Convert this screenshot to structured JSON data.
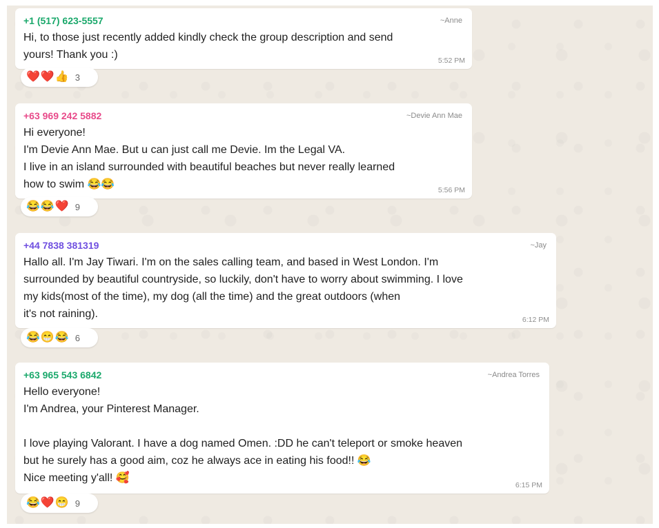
{
  "messages": [
    {
      "phone": "+1 (517) 623-5557",
      "phone_color": "#1aa86b",
      "name": "~Anne",
      "text": "Hi, to those just recently added kindly check the group description and send\nyours! Thank you :)",
      "time": "5:52 PM",
      "reactions": {
        "emojis": [
          "❤️",
          "❤️",
          "👍"
        ],
        "count": "3"
      }
    },
    {
      "phone": "+63 969 242 5882",
      "phone_color": "#e84a8a",
      "name": "~Devie Ann Mae",
      "text": "Hi everyone!\nI'm Devie Ann Mae. But u can just call me Devie. Im the Legal VA.\nI live in an island surrounded with beautiful beaches but never really learned\nhow to swim 😂😂",
      "time": "5:56 PM",
      "reactions": {
        "emojis": [
          "😂",
          "😂",
          "❤️"
        ],
        "count": "9"
      }
    },
    {
      "phone": "+44 7838 381319",
      "phone_color": "#6f4fe0",
      "name": "~Jay",
      "text": "Hallo all. I'm Jay Tiwari. I'm on the sales calling team, and based in West London. I'm\nsurrounded by beautiful countryside, so luckily, don't have to worry about swimming. I love\nmy kids(most of the time), my dog (all the time) and the great outdoors (when\nit's not raining).",
      "time": "6:12 PM",
      "reactions": {
        "emojis": [
          "😂",
          "😁",
          "😂"
        ],
        "count": "6"
      }
    },
    {
      "phone": "+63 965 543 6842",
      "phone_color": "#1aa86b",
      "name": "~Andrea Torres",
      "text": "Hello everyone!\nI'm Andrea, your Pinterest Manager.\n\nI love playing Valorant. I have a dog named Omen. :DD he can't teleport or smoke heaven\nbut he surely has a good aim, coz he always ace in eating his food!! 😂\nNice meeting y'all! 🥰",
      "time": "6:15 PM",
      "reactions": {
        "emojis": [
          "😂",
          "❤️",
          "😁"
        ],
        "count": "9"
      }
    }
  ]
}
